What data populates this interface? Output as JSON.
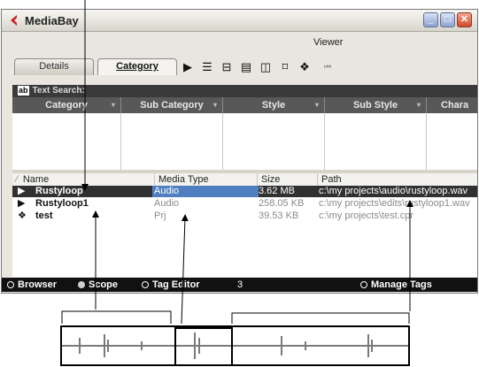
{
  "window": {
    "title": "MediaBay",
    "controls": [
      "minimize",
      "maximize",
      "close"
    ],
    "viewer_label": "Viewer"
  },
  "tabs": [
    {
      "label": "Details",
      "active": false
    },
    {
      "label": "Category",
      "active": true
    }
  ],
  "toolbar_icons": [
    "play-icon",
    "stop-lines-icon",
    "bracket-icon",
    "list-icon",
    "copy-icon",
    "frame-icon",
    "cube-icon",
    "rewind-icon"
  ],
  "search": {
    "icon_text": "ab",
    "label": "Text Search:"
  },
  "category_columns": [
    "Category",
    "Sub Category",
    "Style",
    "Sub Style",
    "Chara"
  ],
  "results": {
    "columns": [
      "Name",
      "Media Type",
      "Size",
      "Path"
    ],
    "rows": [
      {
        "icon": "audio-play-icon",
        "name": "Rustyloop",
        "type": "Audio",
        "size": "3.62 MB",
        "path": "c:\\my projects\\audio\\rustyloop.wav",
        "selected": true
      },
      {
        "icon": "audio-play-icon",
        "name": "Rustyloop1",
        "type": "Audio",
        "size": "258.05 KB",
        "path": "c:\\my projects\\edits\\rustyloop1.wav",
        "selected": false
      },
      {
        "icon": "project-cube-icon",
        "name": "test",
        "type": "Prj",
        "size": "39.53 KB",
        "path": "c:\\my projects\\test.cpr",
        "selected": false
      }
    ]
  },
  "statusbar": {
    "browser": "Browser",
    "scope": "Scope",
    "tag_editor": "Tag Editor",
    "count": "3",
    "manage_tags": "Manage Tags"
  },
  "colors": {
    "selected_row": "#313131",
    "selected_type": "#4f7fbf",
    "header_dark": "#585858",
    "status_bar": "#111111",
    "waveform": "#7a7a7a"
  }
}
